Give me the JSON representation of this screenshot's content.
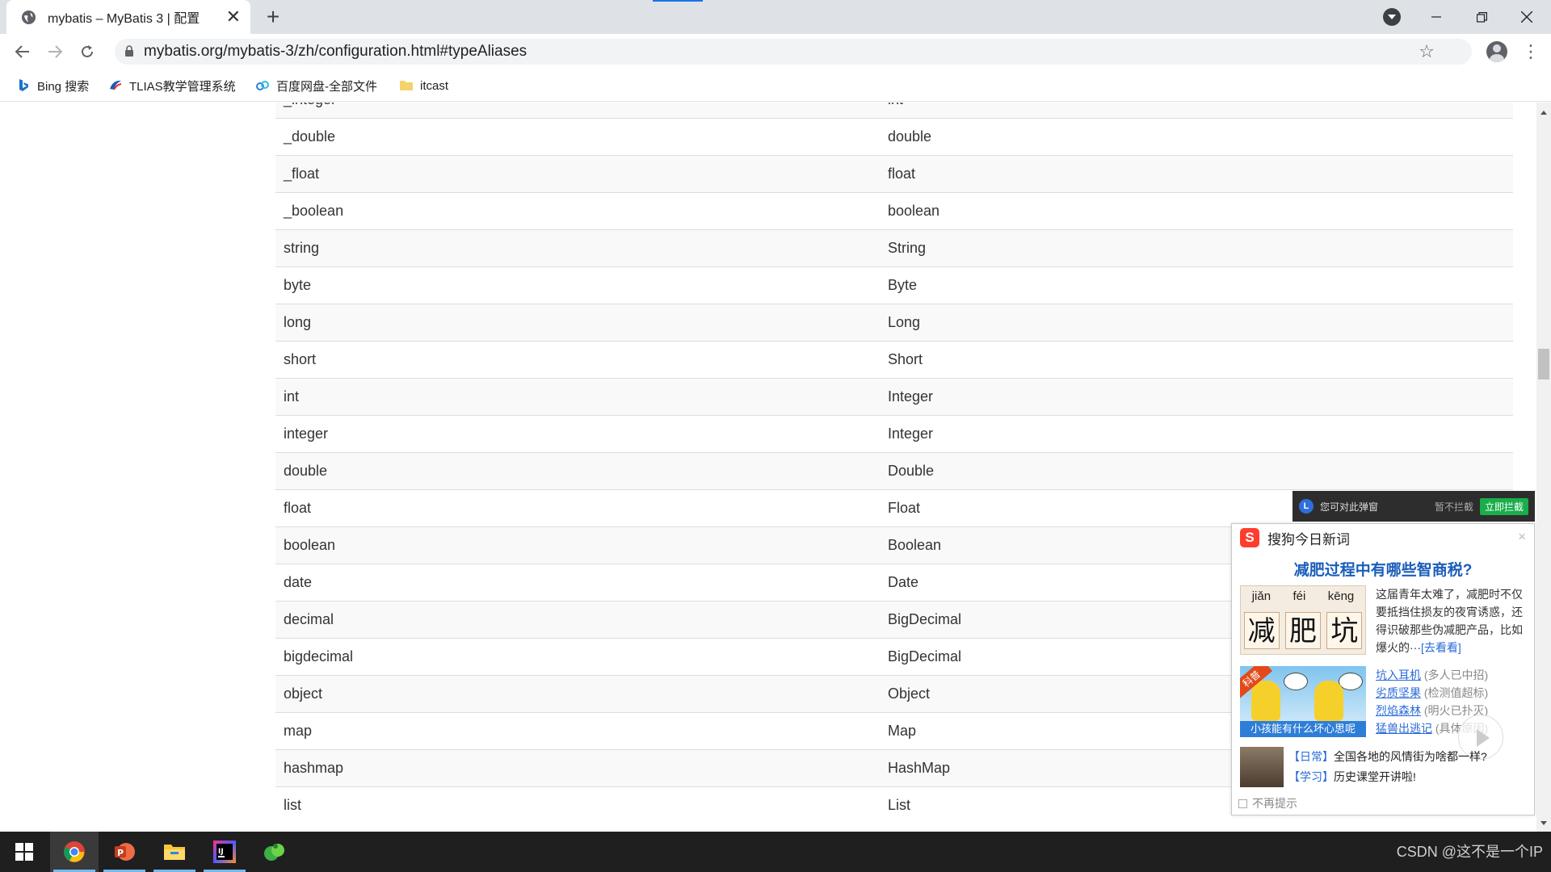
{
  "browser": {
    "tab_title": "mybatis – MyBatis 3 | 配置",
    "tab_close": "✕",
    "new_tab": "+",
    "url": "mybatis.org/mybatis-3/zh/configuration.html#typeAliases"
  },
  "bookmarks": [
    {
      "label": "Bing 搜索",
      "icon": "bing-icon"
    },
    {
      "label": "TLIAS教学管理系统",
      "icon": "tlias-icon"
    },
    {
      "label": "百度网盘-全部文件",
      "icon": "baidu-pan-icon"
    },
    {
      "label": "itcast",
      "icon": "folder-icon"
    }
  ],
  "alias_table": {
    "rows": [
      {
        "alias": "_integer",
        "type": "int"
      },
      {
        "alias": "_double",
        "type": "double"
      },
      {
        "alias": "_float",
        "type": "float"
      },
      {
        "alias": "_boolean",
        "type": "boolean"
      },
      {
        "alias": "string",
        "type": "String"
      },
      {
        "alias": "byte",
        "type": "Byte"
      },
      {
        "alias": "long",
        "type": "Long"
      },
      {
        "alias": "short",
        "type": "Short"
      },
      {
        "alias": "int",
        "type": "Integer"
      },
      {
        "alias": "integer",
        "type": "Integer"
      },
      {
        "alias": "double",
        "type": "Double"
      },
      {
        "alias": "float",
        "type": "Float"
      },
      {
        "alias": "boolean",
        "type": "Boolean"
      },
      {
        "alias": "date",
        "type": "Date"
      },
      {
        "alias": "decimal",
        "type": "BigDecimal"
      },
      {
        "alias": "bigdecimal",
        "type": "BigDecimal"
      },
      {
        "alias": "object",
        "type": "Object"
      },
      {
        "alias": "map",
        "type": "Map"
      },
      {
        "alias": "hashmap",
        "type": "HashMap"
      },
      {
        "alias": "list",
        "type": "List"
      }
    ]
  },
  "intercept_bar": {
    "logo": "L",
    "message": "您可对此弹窗",
    "later": "暂不拦截",
    "button": "立即拦截"
  },
  "popup": {
    "title": "搜狗今日新词",
    "close": "×",
    "headline": "减肥过程中有哪些智商税?",
    "pinyin": [
      "jiǎn",
      "féi",
      "kēng"
    ],
    "hanzi": [
      "减",
      "肥",
      "坑"
    ],
    "story": "这届青年太难了，减肥时不仅要抵挡住损友的夜宵诱惑，还得识破那些伪减肥产品，比如爆火的···",
    "story_more": "[去看看]",
    "minion_tag": "科普",
    "minion_caption": "小孩能有什么坏心思呢",
    "links": [
      {
        "text": "坑入耳机",
        "note": "(多人已中招)"
      },
      {
        "text": "劣质坚果",
        "note": "(检测值超标)"
      },
      {
        "text": "烈焰森林",
        "note": "(明火已扑灭)"
      },
      {
        "text": "猛兽出逃记",
        "note": "(具体原因)"
      }
    ],
    "news": [
      {
        "tag": "【日常】",
        "text": "全国各地的风情街为啥都一样?"
      },
      {
        "tag": "【学习】",
        "text": "历史课堂开讲啦!"
      }
    ],
    "dont_show": "不再提示"
  },
  "taskbar": {
    "items": [
      "windows-start-icon",
      "chrome-icon",
      "powerpoint-icon",
      "file-explorer-icon",
      "intellij-idea-icon",
      "green-app-icon"
    ],
    "watermark": "CSDN @这不是一个IP"
  }
}
